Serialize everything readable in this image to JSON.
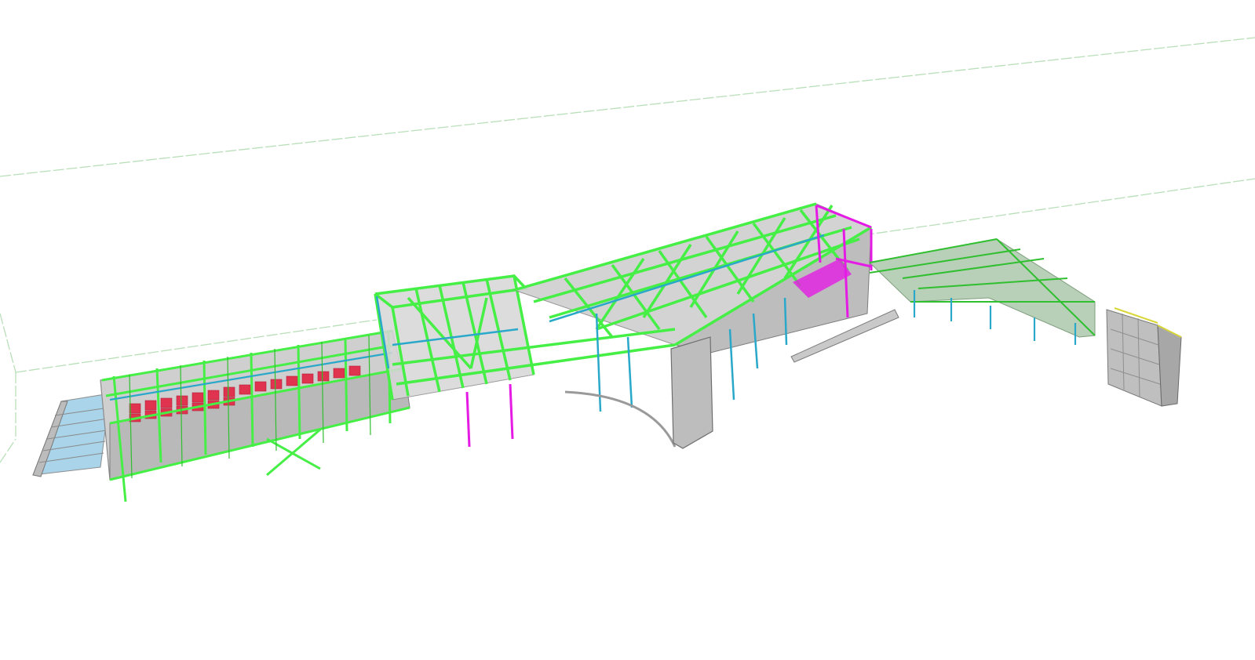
{
  "viewer": {
    "background": "#ffffff",
    "colors": {
      "grid_boundary": "#b9dfb9",
      "steel_green": "#45ef45",
      "steel_green_dark": "#2fbf2f",
      "concrete_grey": "#a7a7a7",
      "concrete_grey_light": "#c9c9c9",
      "cyan_column": "#2aa8c9",
      "magenta_member": "#e51be5",
      "red_seat": "#e0334f",
      "blue_glass": "#a9d4ea",
      "yellow_edge": "#d8d63a"
    },
    "model_elements": [
      "boundary-lines",
      "west-stair",
      "west-stand-building",
      "central-truss-block",
      "main-roof-truss",
      "arched-wall",
      "east-canopy",
      "east-tower"
    ]
  }
}
